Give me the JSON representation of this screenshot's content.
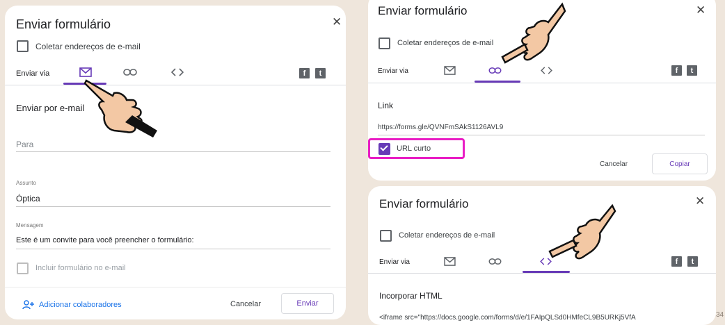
{
  "email_panel": {
    "title": "Enviar formulário",
    "close": "✕",
    "collect_emails_label": "Coletar endereços de e-mail",
    "send_via_label": "Enviar via",
    "section_title": "Enviar por e-mail",
    "to_placeholder": "Para",
    "subject_label": "Assunto",
    "subject_value": "Óptica",
    "message_label": "Mensagem",
    "message_value": "Este é um convite para você preencher o formulário:",
    "include_form_label": "Incluir formulário no e-mail",
    "add_collaborators_label": "Adicionar colaboradores",
    "cancel_label": "Cancelar",
    "send_label": "Enviar",
    "active_tab": "email"
  },
  "link_panel": {
    "title": "Enviar formulário",
    "close": "✕",
    "collect_emails_label": "Coletar endereços de e-mail",
    "send_via_label": "Enviar via",
    "section_title": "Link",
    "link_value": "https://forms.gle/QVNFmSAkS1126AVL9",
    "short_url_label": "URL curto",
    "short_url_checked": true,
    "cancel_label": "Cancelar",
    "copy_label": "Copiar",
    "active_tab": "link"
  },
  "embed_panel": {
    "title": "Enviar formulário",
    "close": "✕",
    "collect_emails_label": "Coletar endereços de e-mail",
    "send_via_label": "Enviar via",
    "section_title": "Incorporar HTML",
    "embed_code": "<iframe src=\"https://docs.google.com/forms/d/e/1FAIpQLSd0HMfeCL9B5URKj5VfA",
    "active_tab": "embed"
  },
  "social": {
    "facebook": "f",
    "twitter": "t"
  },
  "icons": {
    "email_tab": "envelope-icon",
    "link_tab": "link-icon",
    "embed_tab": "code-brackets-icon",
    "pointer": "pointing-hand-icon",
    "add_person": "person-add-icon"
  },
  "colors": {
    "accent": "#673ab7",
    "highlight": "#e91ec4",
    "link_blue": "#1a73e8",
    "background": "#efe6dc"
  },
  "page_number": "34"
}
